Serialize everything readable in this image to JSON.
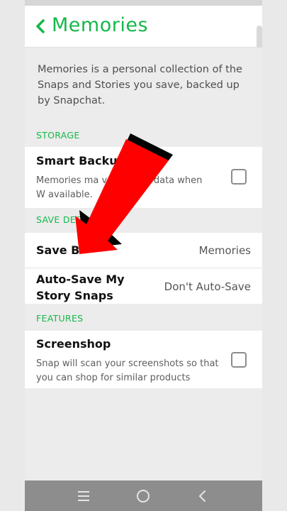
{
  "header": {
    "back_icon": "chevron-left-icon",
    "title": "Memories"
  },
  "intro": "Memories is a personal collection of the Snaps and Stories you save, backed up by Snapchat.",
  "sections": {
    "storage": {
      "label": "STORAGE",
      "smart_backup": {
        "title": "Smart Backu",
        "desc": "Memories ma  ver mobile data when W  available.",
        "checked": false
      }
    },
    "save_destinations": {
      "label": "SAVE DEST",
      "save_button": {
        "title": "Save B",
        "value": "Memories"
      },
      "auto_save": {
        "title": "Auto-Save My Story Snaps",
        "value": "Don't Auto-Save"
      }
    },
    "features": {
      "label": "FEATURES",
      "screenshop": {
        "title": "Screenshop",
        "desc": "Snap will scan your screenshots so that you can shop for similar products",
        "checked": false
      }
    }
  },
  "navbar": {
    "icons": [
      "recent-apps-icon",
      "home-icon",
      "back-nav-icon"
    ]
  },
  "colors": {
    "accent": "#15b84a",
    "arrow": "#ff0000",
    "navbar": "#8d8d8d"
  }
}
